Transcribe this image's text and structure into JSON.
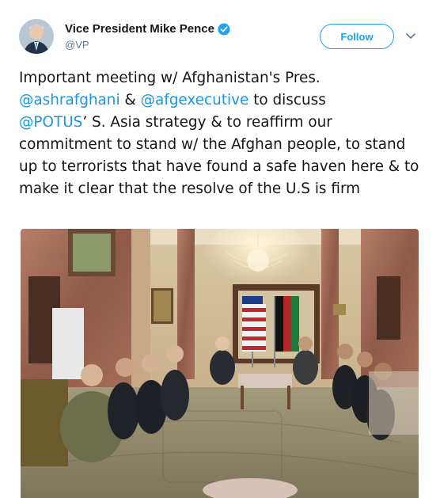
{
  "user": {
    "display_name": "Vice President Mike Pence",
    "handle": "@VP",
    "verified_icon": "verified-badge-icon"
  },
  "actions": {
    "follow_label": "Follow",
    "more_icon": "chevron-down-icon"
  },
  "tweet": {
    "line1": "Important meeting w/ Afghanistan's Pres.",
    "mention1": "@ashrafghani",
    "amp": " & ",
    "mention2": "@afgexecutive",
    "after_mention2": " to discuss",
    "mention3": "@POTUS",
    "rest": "’ S. Asia strategy & to reaffirm our commitment to stand w/ the Afghan people, to stand up to terrorists that have found a safe haven here & to make it clear that the resolve of the U.S is firm"
  },
  "media": {
    "type": "photo"
  },
  "colors": {
    "accent": "#1da1f2",
    "link": "#1b95e0",
    "text": "#14171a",
    "secondary": "#657786"
  }
}
